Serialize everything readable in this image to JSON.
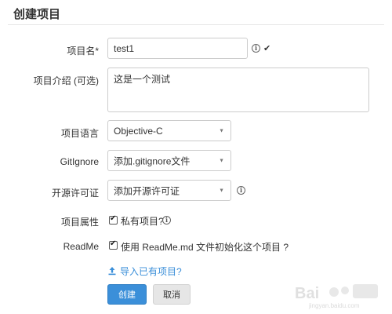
{
  "header": {
    "title": "创建项目"
  },
  "form": {
    "name": {
      "label": "项目名*",
      "value": "test1"
    },
    "description": {
      "label": "项目介绍 (可选)",
      "value": "这是一个测试"
    },
    "language": {
      "label": "项目语言",
      "selected": "Objective-C"
    },
    "gitignore": {
      "label": "GitIgnore",
      "selected": "添加.gitignore文件"
    },
    "license": {
      "label": "开源许可证",
      "selected": "添加开源许可证"
    },
    "attributes": {
      "label": "项目属性",
      "private_label": "私有项目?",
      "private_checked": true
    },
    "readme": {
      "label": "ReadMe",
      "init_label": "使用 ReadMe.md 文件初始化这个项目 ?",
      "init_checked": true
    },
    "import_link": "导入已有项目?"
  },
  "actions": {
    "create_label": "创建",
    "cancel_label": "取消"
  },
  "watermark": {
    "logo_text": "Bai",
    "site_text": "jingyan.baidu.com"
  },
  "icons": {
    "info": "info-icon",
    "valid": "check-icon",
    "upload": "upload-icon",
    "caret": "caret-down-icon"
  },
  "colors": {
    "primary": "#3b8fd9",
    "link": "#3b8fd9",
    "border": "#cccccc"
  }
}
